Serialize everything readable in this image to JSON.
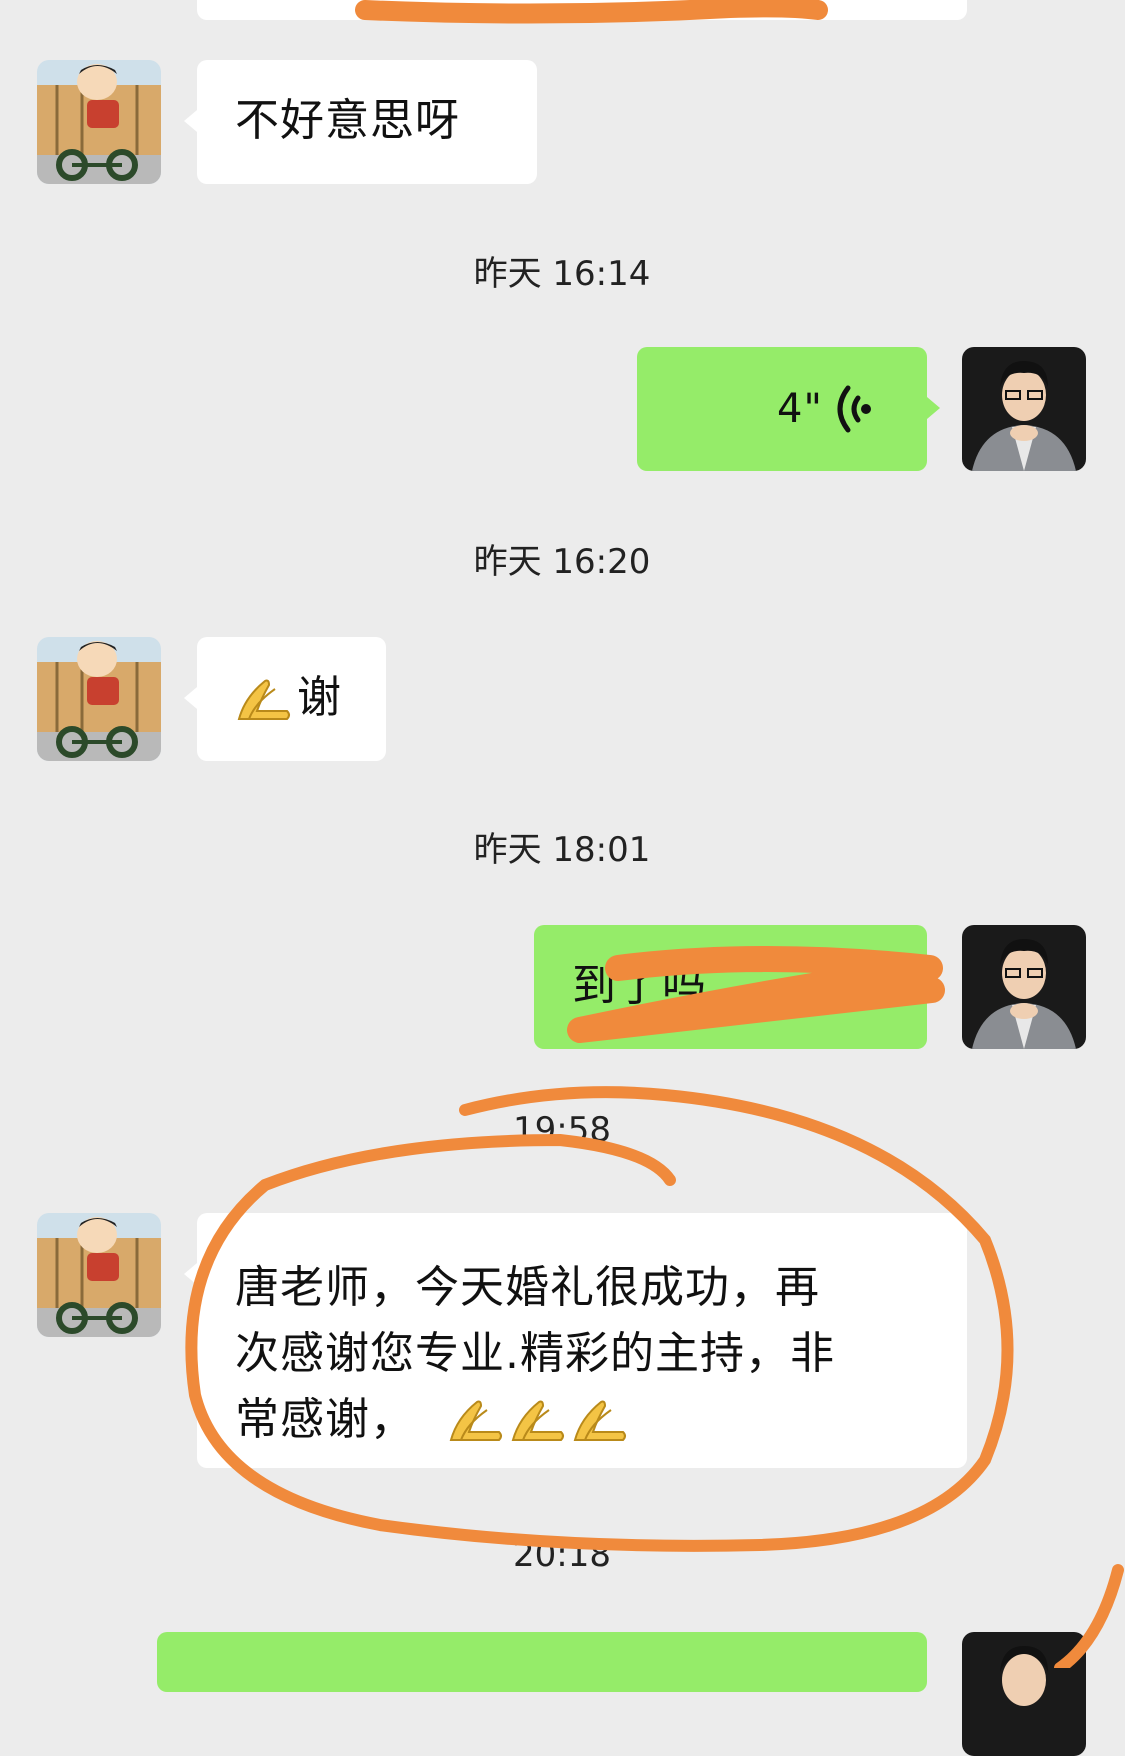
{
  "chat": {
    "messages": [
      {
        "side": "left",
        "type": "text",
        "text": "不好意思呀"
      },
      {
        "side": "right",
        "type": "voice",
        "duration": "4\""
      },
      {
        "side": "left",
        "type": "text",
        "text": "谢"
      },
      {
        "side": "right",
        "type": "text",
        "text": "到了吗"
      },
      {
        "side": "left",
        "type": "text",
        "lines": [
          "唐老师，今天婚礼很成功，再",
          "次感谢您专业.精彩的主持，非",
          "常感谢，"
        ]
      }
    ],
    "timestamps": [
      "昨天 16:14",
      "昨天 16:20",
      "昨天 18:01",
      "19:58",
      "20:18"
    ]
  },
  "colors": {
    "background": "#ececec",
    "incoming_bubble": "#ffffff",
    "outgoing_bubble": "#95ec69",
    "annotation": "#f08a3c"
  },
  "icons": {
    "voice": "voice-wave-icon",
    "emoji": "folded-hands-emoji"
  }
}
